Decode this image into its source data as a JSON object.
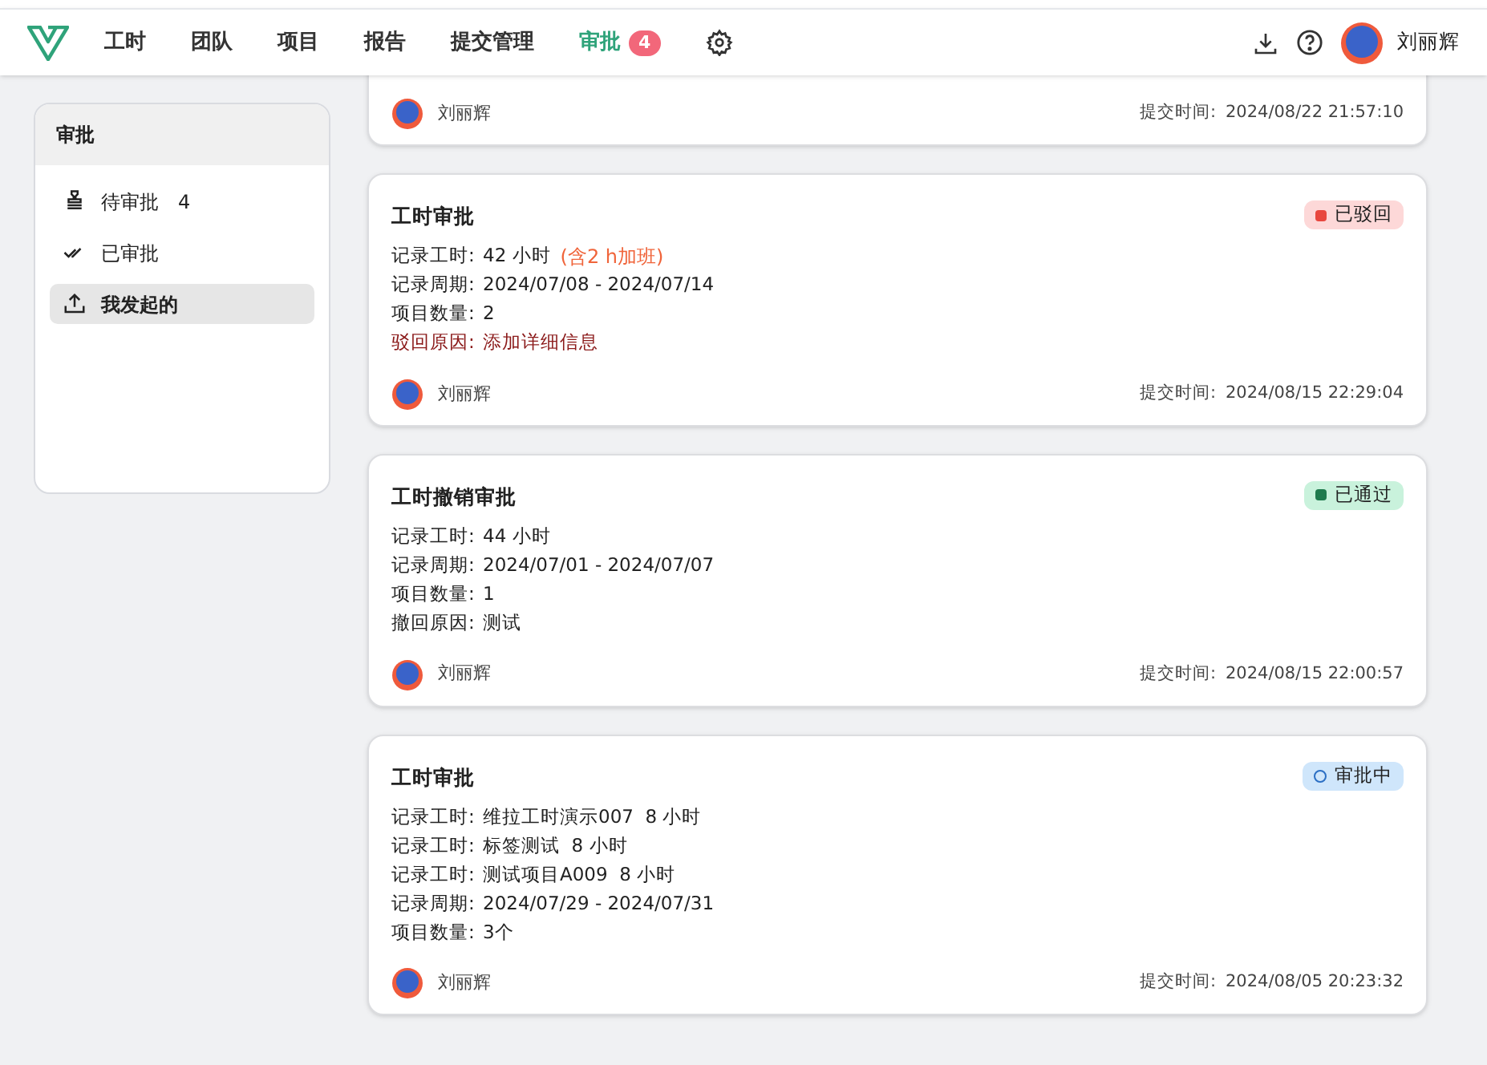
{
  "nav": {
    "items": [
      {
        "label": "工时",
        "selected": false
      },
      {
        "label": "团队",
        "selected": false
      },
      {
        "label": "项目",
        "selected": false
      },
      {
        "label": "报告",
        "selected": false
      },
      {
        "label": "提交管理",
        "selected": false
      },
      {
        "label": "审批",
        "selected": true,
        "badge": "4"
      }
    ],
    "user": "刘丽辉"
  },
  "sidebar": {
    "title": "审批",
    "items": [
      {
        "kind": "stamp",
        "label": "待审批",
        "count": "4",
        "selected": false
      },
      {
        "kind": "check",
        "label": "已审批",
        "selected": false
      },
      {
        "kind": "upload",
        "label": "我发起的",
        "selected": true
      }
    ]
  },
  "cards": [
    {
      "user": "刘丽辉",
      "submit_label": "提交时间:",
      "submit_time": "2024/08/22 21:57:10"
    },
    {
      "title": "工时审批",
      "status": {
        "kind": "rejected",
        "label": "已驳回"
      },
      "lines": [
        {
          "kind": "normal",
          "label": "记录工时:",
          "value": "42 小时",
          "note": "(含2 h加班)"
        },
        {
          "kind": "normal",
          "label": "记录周期:",
          "value": "2024/07/08 - 2024/07/14"
        },
        {
          "kind": "normal",
          "label": "项目数量:",
          "value": "2"
        },
        {
          "kind": "reason",
          "label": "驳回原因:",
          "value": "添加详细信息"
        }
      ],
      "user": "刘丽辉",
      "submit_label": "提交时间:",
      "submit_time": "2024/08/15 22:29:04"
    },
    {
      "title": "工时撤销审批",
      "status": {
        "kind": "approved",
        "label": "已通过"
      },
      "lines": [
        {
          "kind": "normal",
          "label": "记录工时:",
          "value": "44 小时"
        },
        {
          "kind": "normal",
          "label": "记录周期:",
          "value": "2024/07/01 - 2024/07/07"
        },
        {
          "kind": "normal",
          "label": "项目数量:",
          "value": "1"
        },
        {
          "kind": "normal",
          "label": "撤回原因:",
          "value": "测试"
        }
      ],
      "user": "刘丽辉",
      "submit_label": "提交时间:",
      "submit_time": "2024/08/15 22:00:57"
    },
    {
      "title": "工时审批",
      "status": {
        "kind": "pending",
        "label": "审批中"
      },
      "lines": [
        {
          "kind": "normal",
          "label": "记录工时:",
          "value": "维拉工时演示007  8 小时"
        },
        {
          "kind": "normal",
          "label": "记录工时:",
          "value": "标签测试  8 小时"
        },
        {
          "kind": "normal",
          "label": "记录工时:",
          "value": "测试项目A009  8 小时"
        },
        {
          "kind": "normal",
          "label": "记录周期:",
          "value": "2024/07/29 - 2024/07/31"
        },
        {
          "kind": "normal",
          "label": "项目数量:",
          "value": "3个"
        }
      ],
      "user": "刘丽辉",
      "submit_label": "提交时间:",
      "submit_time": "2024/08/05 20:23:32"
    }
  ]
}
